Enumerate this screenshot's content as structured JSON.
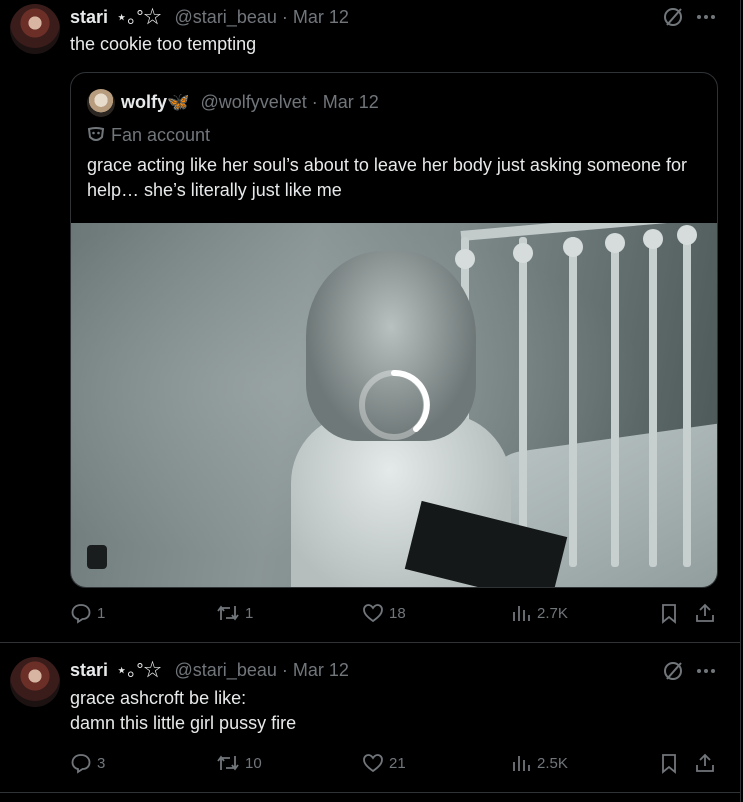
{
  "posts": [
    {
      "author_name": "stari",
      "author_deco": "⋆｡°☆",
      "handle": "@stari_beau",
      "separator": "·",
      "date": "Mar 12",
      "text": "the cookie too tempting",
      "quote": {
        "author_name": "wolfy",
        "author_emoji": "🦋",
        "handle": "@wolfyvelvet",
        "separator": "·",
        "date": "Mar 12",
        "label": "Fan account",
        "text": "grace acting like her soul’s about to leave her body just asking someone for help… she’s literally just like me",
        "media": {
          "type": "video",
          "state": "loading"
        }
      },
      "stats": {
        "replies": "1",
        "reposts": "1",
        "likes": "18",
        "views": "2.7K"
      }
    },
    {
      "author_name": "stari",
      "author_deco": "⋆｡°☆",
      "handle": "@stari_beau",
      "separator": "·",
      "date": "Mar 12",
      "text_lines": [
        "grace ashcroft be like:",
        "damn this little girl pussy fire"
      ],
      "stats": {
        "replies": "3",
        "reposts": "10",
        "likes": "21",
        "views": "2.5K"
      }
    }
  ],
  "icons": {
    "grok": "slashed-circle-icon",
    "more": "more-dots-icon",
    "reply": "reply-icon",
    "repost": "repost-icon",
    "like": "heart-icon",
    "views": "views-icon",
    "bookmark": "bookmark-icon",
    "share": "share-icon",
    "fan": "mask-icon"
  },
  "colors": {
    "background": "#000000",
    "text": "#e7e9ea",
    "muted": "#71767b",
    "border": "#2f3336",
    "butterfly": "#4aa3df"
  }
}
